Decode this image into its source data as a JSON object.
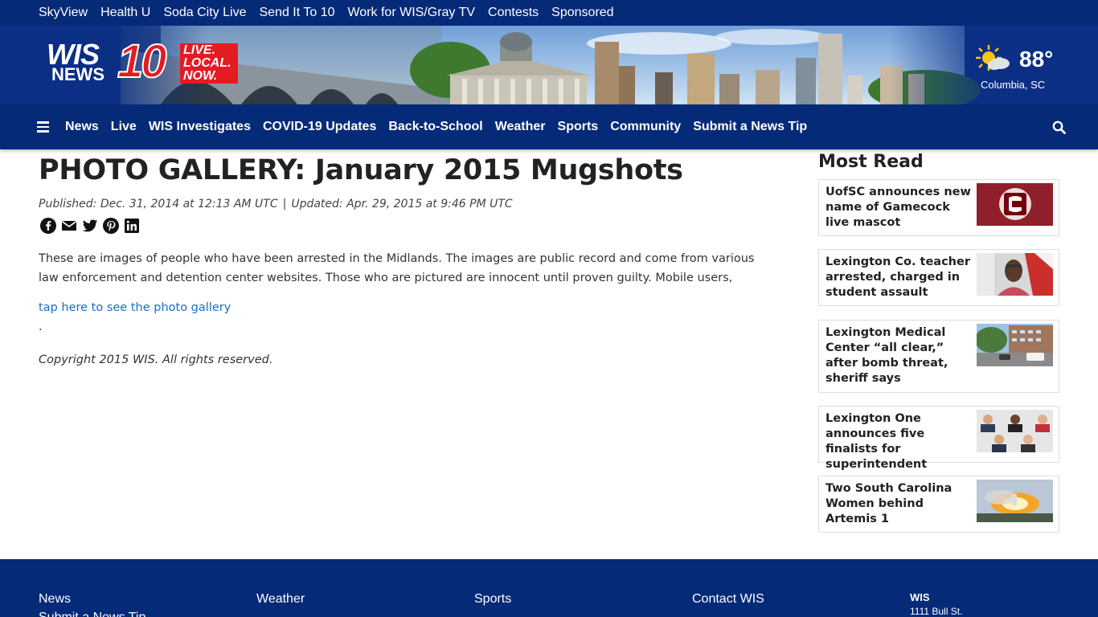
{
  "topbar": {
    "links": [
      "SkyView",
      "Health U",
      "Soda City Live",
      "Send It To 10",
      "Work for WIS/Gray TV",
      "Contests",
      "Sponsored"
    ]
  },
  "logo": {
    "wis": "WIS",
    "news": "NEWS",
    "ten": "10",
    "tagline": [
      "LIVE.",
      "LOCAL.",
      "NOW."
    ]
  },
  "weather": {
    "temp": "88°",
    "location": "Columbia, SC",
    "icon": "partly-cloudy-icon"
  },
  "nav": {
    "menu_icon": "hamburger-menu-icon",
    "items": [
      "News",
      "Live",
      "WIS Investigates",
      "COVID-19 Updates",
      "Back-to-School",
      "Weather",
      "Sports",
      "Community",
      "Submit a News Tip"
    ],
    "search_icon": "search-icon"
  },
  "article": {
    "headline": "PHOTO GALLERY: January 2015 Mugshots",
    "published": "Published: Dec. 31, 2014 at 12:13 AM UTC",
    "separator": "|",
    "updated": "Updated: Apr. 29, 2015 at 9:46 PM UTC",
    "share_icons": [
      "facebook-icon",
      "email-icon",
      "twitter-icon",
      "pinterest-icon",
      "linkedin-icon"
    ],
    "body": "These are images of people who have been arrested in the Midlands. The images are public record and come from various law enforcement and detention center websites. Those who are pictured are innocent until proven guilty. Mobile users,",
    "gallery_link": "tap here to see the photo gallery",
    "trailing_period": ".",
    "copyright": "Copyright 2015 WIS. All rights reserved."
  },
  "sidebar": {
    "title": "Most Read",
    "items": [
      {
        "title": "UofSC announces new name of Gamecock live mascot"
      },
      {
        "title": "Lexington Co. teacher arrested, charged in student assault"
      },
      {
        "title": "Lexington Medical Center “all clear,” after bomb threat, sheriff says"
      },
      {
        "title": "Lexington One announces five finalists for superintendent"
      },
      {
        "title": "Two South Carolina Women behind Artemis 1"
      }
    ]
  },
  "footer": {
    "columns": [
      "News",
      "Weather",
      "Sports",
      "Contact WIS"
    ],
    "sub_link": "Submit a News Tip",
    "station": "WIS",
    "address": "1111 Bull St."
  },
  "colors": {
    "navy": "#052a78",
    "brand_red": "#e31b23",
    "link_blue": "#1a6dc8"
  }
}
